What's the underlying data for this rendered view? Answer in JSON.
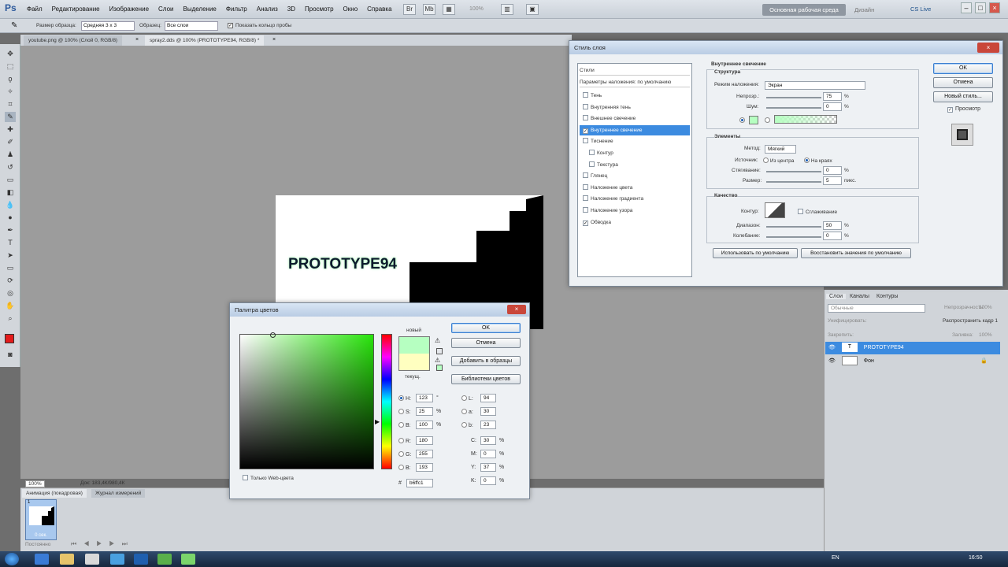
{
  "menu": [
    "Файл",
    "Редактирование",
    "Изображение",
    "Слои",
    "Выделение",
    "Фильтр",
    "Анализ",
    "3D",
    "Просмотр",
    "Окно",
    "Справка"
  ],
  "zoom_menu": "100%",
  "workspace": "Основная рабочая среда",
  "design": "Дизайн",
  "cslive": "CS Live",
  "options": {
    "sample_size_label": "Размер образца:",
    "sample_size": "Средняя 3 х 3",
    "sample_label": "Образец:",
    "sample": "Все слои",
    "show_ring": "Показать кольцо пробы"
  },
  "tabs": [
    "youtube.png @ 100% (Слой 0, RGB/8)",
    "spray2.dds @ 100% (PROTOTYPE94, RGB/8) *"
  ],
  "doc_text": "PROTOTYPE94",
  "status": {
    "zoom": "100%",
    "doc": "Док: 183,4К/980,4К"
  },
  "anim_tabs": [
    "Анимация (покадровая)",
    "Журнал измерений"
  ],
  "frame": {
    "num": "1",
    "delay": "0 сек."
  },
  "anim_loop": "Постоянно",
  "layers_panel": {
    "tabs": [
      "Слои",
      "Каналы",
      "Контуры"
    ],
    "blend": "Обычные",
    "opacity_label": "Непрозрачность:",
    "opacity": "100%",
    "unify_label": "Унифицировать:",
    "propagate": "Распространить кадр 1",
    "lock_label": "Закрепить:",
    "fill_label": "Заливка:",
    "fill": "100%",
    "layers": [
      {
        "name": "PROTOTYPE94"
      },
      {
        "name": "Фон"
      }
    ]
  },
  "taskbar": {
    "lang": "EN",
    "clock": "16:50"
  },
  "layer_style": {
    "title": "Стиль слоя",
    "list_header": "Стили",
    "list_sub": "Параметры наложения: по умолчанию",
    "items": [
      {
        "label": "Тень",
        "checked": false
      },
      {
        "label": "Внутренняя тень",
        "checked": false
      },
      {
        "label": "Внешнее свечение",
        "checked": false
      },
      {
        "label": "Внутреннее свечение",
        "checked": true,
        "selected": true
      },
      {
        "label": "Тиснение",
        "checked": false
      },
      {
        "label": "Контур",
        "checked": false
      },
      {
        "label": "Текстура",
        "checked": false
      },
      {
        "label": "Глянец",
        "checked": false
      },
      {
        "label": "Наложение цвета",
        "checked": false
      },
      {
        "label": "Наложение градиента",
        "checked": false
      },
      {
        "label": "Наложение узора",
        "checked": false
      },
      {
        "label": "Обводка",
        "checked": true
      }
    ],
    "section_title": "Внутреннее свечение",
    "structure": "Структура",
    "blend_label": "Режим наложения:",
    "blend": "Экран",
    "opacity_label": "Непрозр.:",
    "opacity": "75",
    "noise_label": "Шум:",
    "noise": "0",
    "pct": "%",
    "elements": "Элементы",
    "method_label": "Метод:",
    "method": "Мягкий",
    "source_label": "Источник:",
    "from_center": "Из центра",
    "on_edge": "На краях",
    "choke_label": "Стягивание:",
    "choke": "0",
    "size_label": "Размер:",
    "size": "5",
    "px": "пикс.",
    "quality": "Качество",
    "contour_label": "Контур:",
    "antialias": "Сглаживание",
    "range_label": "Диапазон:",
    "range": "50",
    "jitter_label": "Колебание:",
    "jitter": "0",
    "make_default": "Использовать по умолчанию",
    "reset_default": "Восстановить значения по умолчанию",
    "ok": "OK",
    "cancel": "Отмена",
    "new_style": "Новый стиль...",
    "preview": "Просмотр",
    "glow_color": "#b6ffc1"
  },
  "color_picker": {
    "title": "Палитра цветов",
    "new_label": "новый",
    "current_label": "текущ.",
    "ok": "OK",
    "cancel": "Отмена",
    "add_swatch": "Добавить в образцы",
    "libraries": "Библиотеки цветов",
    "web_only": "Только Web-цвета",
    "H": "123",
    "S": "25",
    "B": "100",
    "R": "180",
    "G": "255",
    "Bl": "193",
    "L": "94",
    "a": "30",
    "b": "23",
    "C": "30",
    "M": "0",
    "Y": "37",
    "K": "0",
    "deg": "°",
    "pct": "%",
    "hex": "b6ffc1",
    "new_color": "#b6ffc1",
    "current_color": "#ffffc0"
  }
}
